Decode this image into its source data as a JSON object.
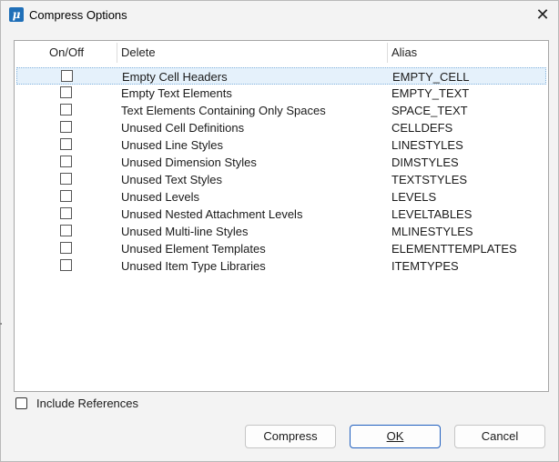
{
  "window": {
    "title": "Compress Options",
    "app_icon": "microstation-logo-icon",
    "close_glyph": "✕"
  },
  "list": {
    "columns": [
      "On/Off",
      "Delete",
      "Alias"
    ],
    "rows": [
      {
        "delete": "Empty Cell Headers",
        "alias": "EMPTY_CELL",
        "checked": false,
        "selected": true
      },
      {
        "delete": "Empty Text Elements",
        "alias": "EMPTY_TEXT",
        "checked": false
      },
      {
        "delete": "Text Elements Containing Only Spaces",
        "alias": "SPACE_TEXT",
        "checked": false
      },
      {
        "delete": "Unused Cell Definitions",
        "alias": "CELLDEFS",
        "checked": false
      },
      {
        "delete": "Unused Line Styles",
        "alias": "LINESTYLES",
        "checked": false
      },
      {
        "delete": "Unused Dimension Styles",
        "alias": "DIMSTYLES",
        "checked": false
      },
      {
        "delete": "Unused Text Styles",
        "alias": "TEXTSTYLES",
        "checked": false
      },
      {
        "delete": "Unused Levels",
        "alias": "LEVELS",
        "checked": false
      },
      {
        "delete": "Unused Nested Attachment Levels",
        "alias": "LEVELTABLES",
        "checked": false
      },
      {
        "delete": "Unused Multi-line Styles",
        "alias": "MLINESTYLES",
        "checked": false
      },
      {
        "delete": "Unused Element Templates",
        "alias": "ELEMENTTEMPLATES",
        "checked": false
      },
      {
        "delete": "Unused Item Type Libraries",
        "alias": "ITEMTYPES",
        "checked": false
      }
    ]
  },
  "include_references": {
    "label": "Include References",
    "checked": false
  },
  "buttons": {
    "compress": "Compress",
    "ok": "OK",
    "cancel": "Cancel"
  },
  "colors": {
    "selection": "#e5f1fb",
    "accent": "#1f5fbf",
    "app_icon": "#1f6fb8"
  }
}
